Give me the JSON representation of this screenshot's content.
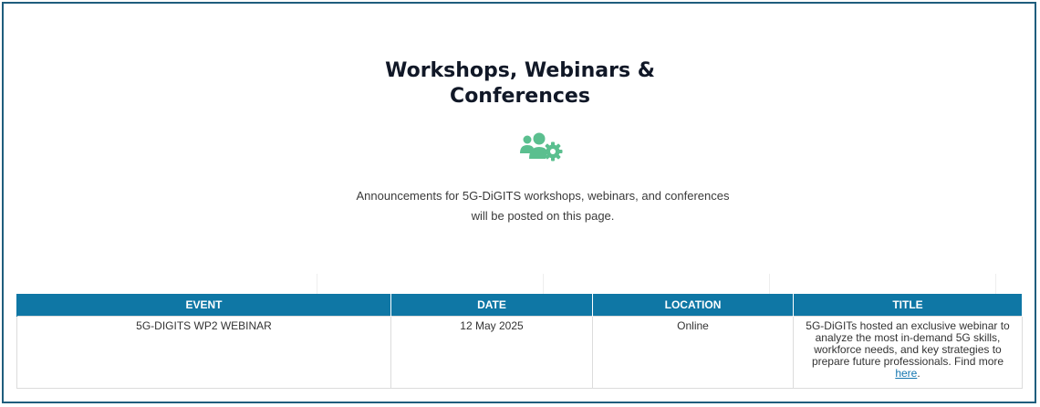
{
  "section": {
    "heading_line1": "Workshops, Webinars &",
    "heading_line2": "Conferences",
    "icon": "users-gear-icon",
    "description": "Announcements for 5G-DiGITS workshops, webinars, and conferences will be posted on this page."
  },
  "colors": {
    "accent_icon": "#5bbf8f",
    "table_header_bg": "#0f77a5",
    "frame_border": "#1f5d7d"
  },
  "table": {
    "headers": [
      "EVENT",
      "DATE",
      "LOCATION",
      "TITLE"
    ],
    "rows": [
      {
        "event": "5G-DIGITS WP2 WEBINAR",
        "date": "12 May 2025",
        "location": "Online",
        "title_text": "5G-DiGITs hosted an exclusive webinar to analyze the most in-demand 5G skills, workforce needs, and key strategies to prepare future professionals. Find more",
        "link_text": "here",
        "title_end": "."
      }
    ]
  }
}
